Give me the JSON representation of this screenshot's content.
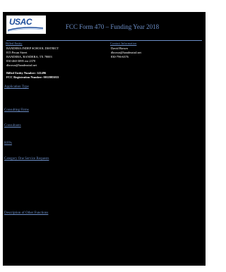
{
  "header": {
    "logo_text": "USAC",
    "title": "FCC Form 470 – Funding Year 2018"
  },
  "billed_entity": {
    "heading": "Billed Entity",
    "lines": [
      "BANDERA INDEP SCHOOL DISTRICT",
      "815 Pecan Street",
      "BANDERA, BANDERA, TX 78003",
      "830-460-3895 ext 2370",
      "dbrown@banderaisd.net"
    ],
    "entity_number": "Billed Entity Number: 141496",
    "fcc_registration": "FCC Registration Number: 0011985033"
  },
  "contact": {
    "heading": "Contact Information",
    "lines": [
      "David Brown",
      "dbrown@banderaisd.net",
      "830-796-6376"
    ]
  },
  "sections": [
    "Application Type",
    "Consulting Firms",
    "Consultants",
    "RFPs",
    "Category One Service Requests",
    "Description of Other Functions"
  ],
  "colors": {
    "accent": "#6d8fc8",
    "background": "#000000",
    "logo": "#1f4e9c"
  }
}
